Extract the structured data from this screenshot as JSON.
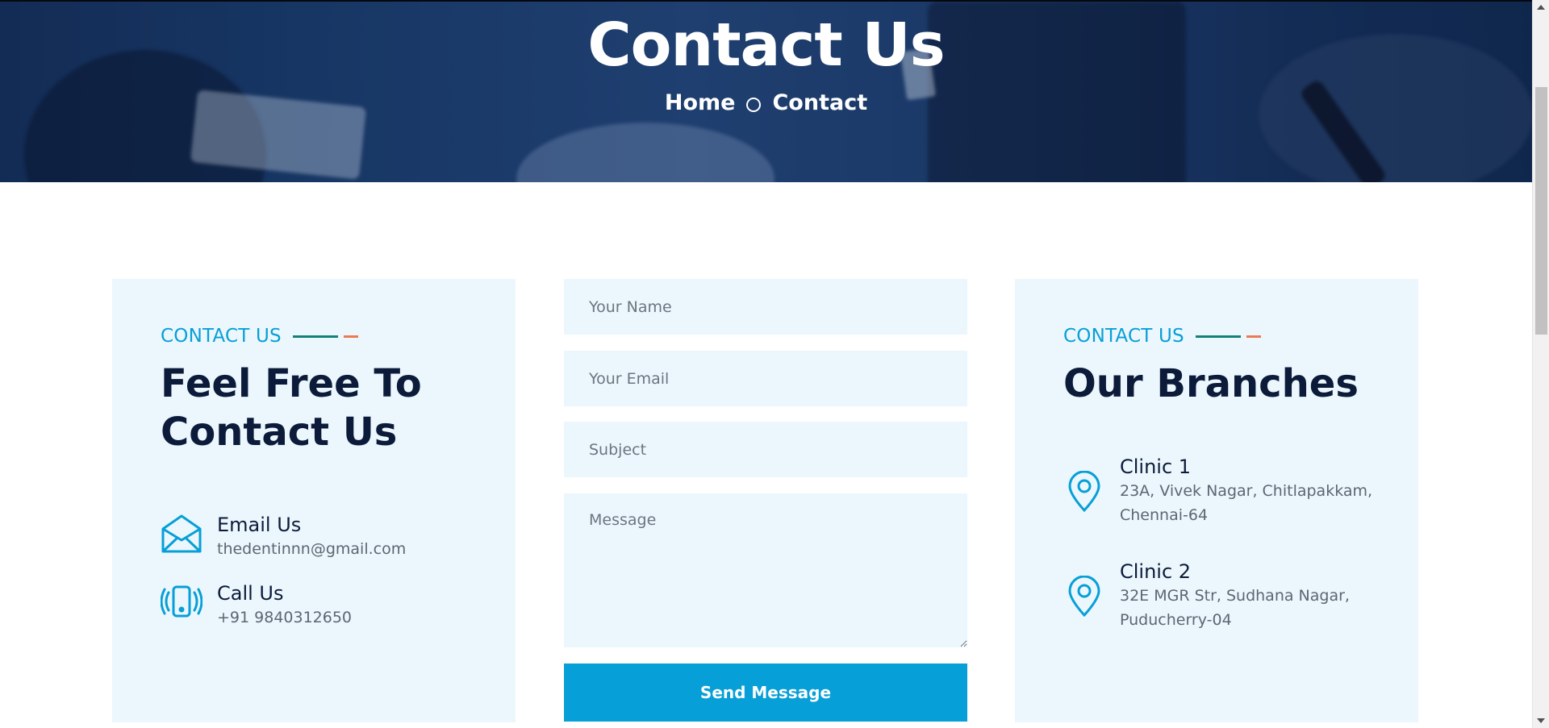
{
  "hero": {
    "title": "Contact Us",
    "breadcrumb": {
      "home": "Home",
      "current": "Contact"
    }
  },
  "contact_card": {
    "tagline": "CONTACT US",
    "heading_line1": "Feel Free To",
    "heading_line2": "Contact Us",
    "items": [
      {
        "icon": "envelope-icon",
        "title": "Email Us",
        "text": "thedentinnn@gmail.com"
      },
      {
        "icon": "phone-vibrate-icon",
        "title": "Call Us",
        "text": "+91 9840312650"
      }
    ]
  },
  "form": {
    "name_placeholder": "Your Name",
    "email_placeholder": "Your Email",
    "subject_placeholder": "Subject",
    "message_placeholder": "Message",
    "submit_label": "Send Message"
  },
  "branches_card": {
    "tagline": "CONTACT US",
    "heading": "Our Branches",
    "branches": [
      {
        "icon": "location-pin-icon",
        "name": "Clinic 1",
        "address_line1": "23A, Vivek Nagar, Chitlapakkam,",
        "address_line2": "Chennai-64"
      },
      {
        "icon": "location-pin-icon",
        "name": "Clinic 2",
        "address_line1": "32E MGR Str, Sudhana Nagar,",
        "address_line2": "Puducherry-04"
      }
    ]
  },
  "colors": {
    "accent": "#079fd7",
    "heading": "#0c1b3a",
    "card_bg": "#ecf7fd",
    "tag_line_teal": "#13807a",
    "tag_line_orange": "#ec7b52",
    "hero_overlay": "#173664"
  }
}
